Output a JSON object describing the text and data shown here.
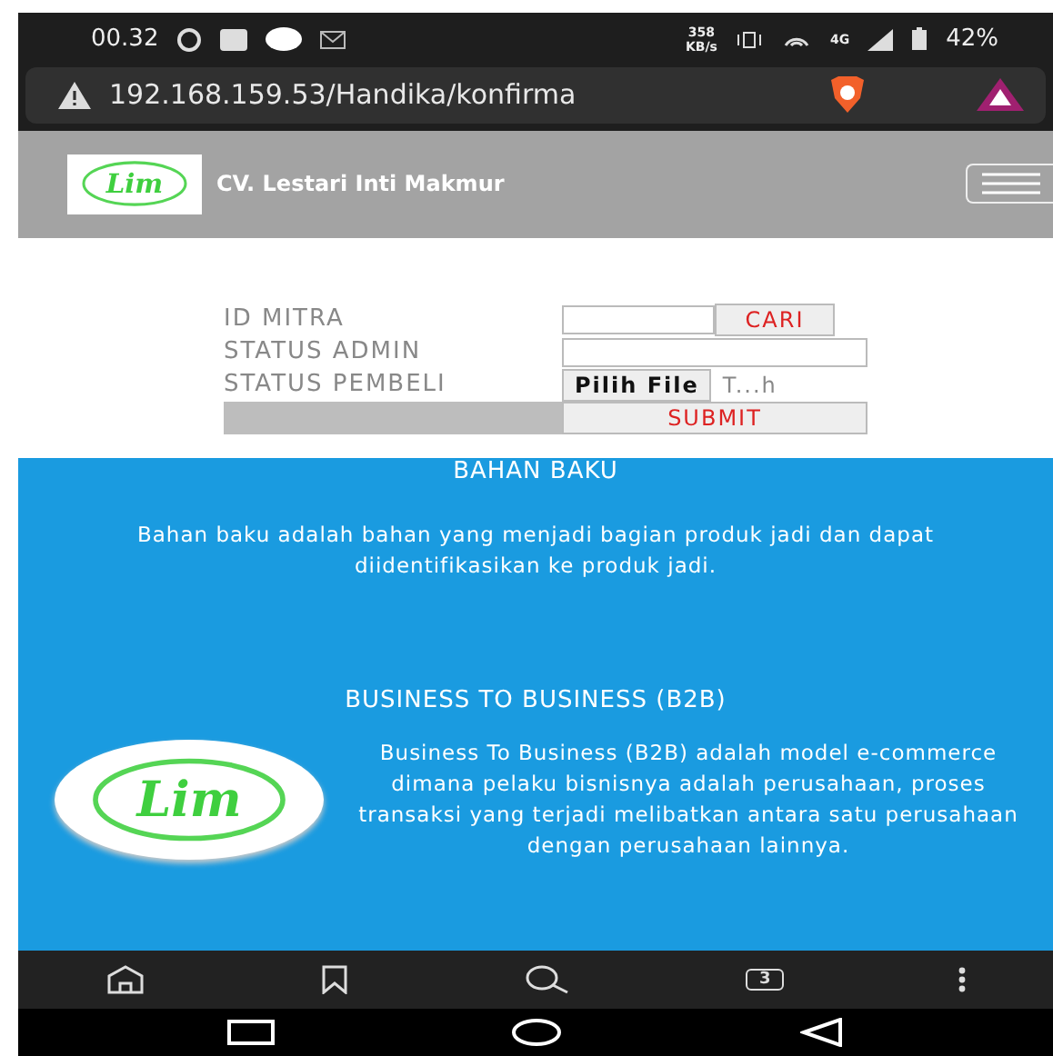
{
  "status_bar": {
    "time": "00.32",
    "speed": "358",
    "speed_unit": "KB/s",
    "network": "4G",
    "battery": "42%"
  },
  "address_bar": {
    "url": "192.168.159.53/Handika/konfirma"
  },
  "header": {
    "logo_text": "Lim",
    "title": "CV. Lestari Inti Makmur"
  },
  "form": {
    "rows": [
      {
        "kind": "search",
        "label": "ID MITRA",
        "button": "CARI"
      },
      {
        "kind": "text",
        "label": "STATUS ADMIN"
      },
      {
        "kind": "file",
        "label": "STATUS PEMBELI",
        "button": "Pilih File",
        "file_text": "T...h"
      },
      {
        "kind": "submit",
        "button": "SUBMIT"
      }
    ]
  },
  "sections": [
    {
      "title": "BAHAN BAKU",
      "text": "Bahan baku adalah bahan yang menjadi bagian produk jadi dan dapat diidentifikasikan ke produk jadi."
    },
    {
      "title": "BUSINESS TO BUSINESS (B2B)",
      "logo_text": "Lim",
      "text": "Business To Business (B2B) adalah model e-commerce dimana pelaku bisnisnya adalah perusahaan, proses transaksi yang terjadi melibatkan antara satu perusahaan dengan perusahaan lainnya."
    }
  ],
  "browser_nav": {
    "tab_count": "3"
  }
}
